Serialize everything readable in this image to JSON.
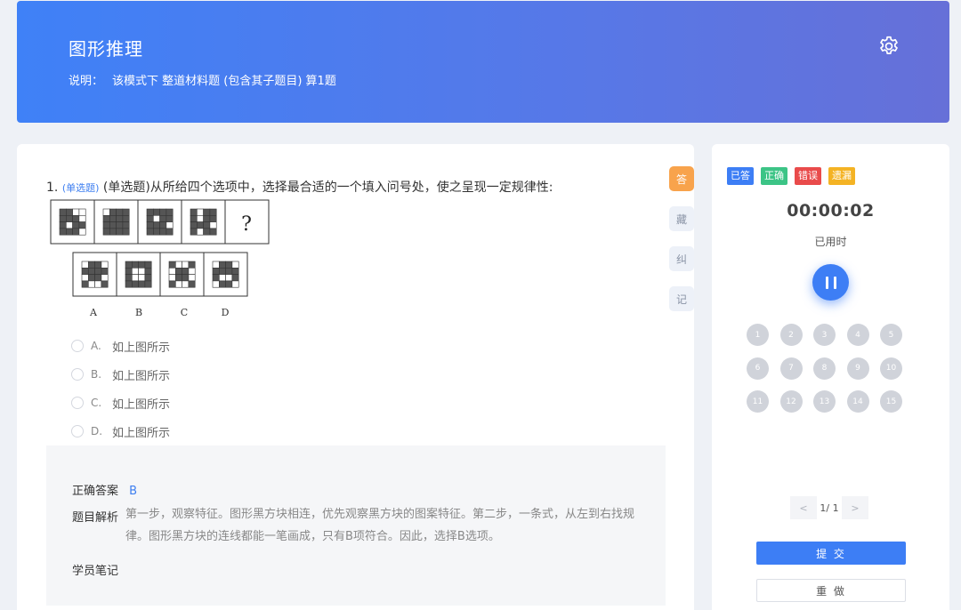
{
  "header": {
    "title": "图形推理",
    "desc_label": "说明：",
    "desc_text": "该模式下 整道材料题 (包含其子题目) 算1题"
  },
  "question": {
    "number": "1.",
    "type_tag": "(单选题)",
    "text": "(单选题)从所给四个选项中，选择最合适的一个填入问号处，使之呈现一定规律性:",
    "question_mark": "?",
    "option_letters": [
      "A",
      "B",
      "C",
      "D"
    ],
    "options": [
      {
        "letter": "A.",
        "text": "如上图所示"
      },
      {
        "letter": "B.",
        "text": "如上图所示"
      },
      {
        "letter": "C.",
        "text": "如上图所示"
      },
      {
        "letter": "D.",
        "text": "如上图所示"
      }
    ]
  },
  "answer": {
    "correct_label": "正确答案",
    "correct_value": "B",
    "analysis_label": "题目解析",
    "analysis_text": "第一步，观察特征。图形黑方块相连，优先观察黑方块的图案特征。第二步，一条式，从左到右找规律。图形黑方块的连线都能一笔画成，只有B项符合。因此，选择B选项。",
    "notes_label": "学员笔记"
  },
  "side_tabs": [
    "答",
    "藏",
    "纠",
    "记"
  ],
  "panel": {
    "legend": [
      {
        "label": "已答",
        "color": "#3d7ef5"
      },
      {
        "label": "正确",
        "color": "#3cc486"
      },
      {
        "label": "错误",
        "color": "#e94b4b"
      },
      {
        "label": "遗漏",
        "color": "#f4b324"
      }
    ],
    "timer": "00:00:02",
    "timer_label": "已用时",
    "numbers": [
      "1",
      "2",
      "3",
      "4",
      "5",
      "6",
      "7",
      "8",
      "9",
      "10",
      "11",
      "12",
      "13",
      "14",
      "15"
    ],
    "pager": {
      "prev": "<",
      "text": "1/ 1",
      "next": ">"
    },
    "submit_label": "提 交",
    "redo_label": "重 做"
  },
  "colors": {
    "accent": "#3d7ef5",
    "active_tab": "#f8a34c"
  }
}
